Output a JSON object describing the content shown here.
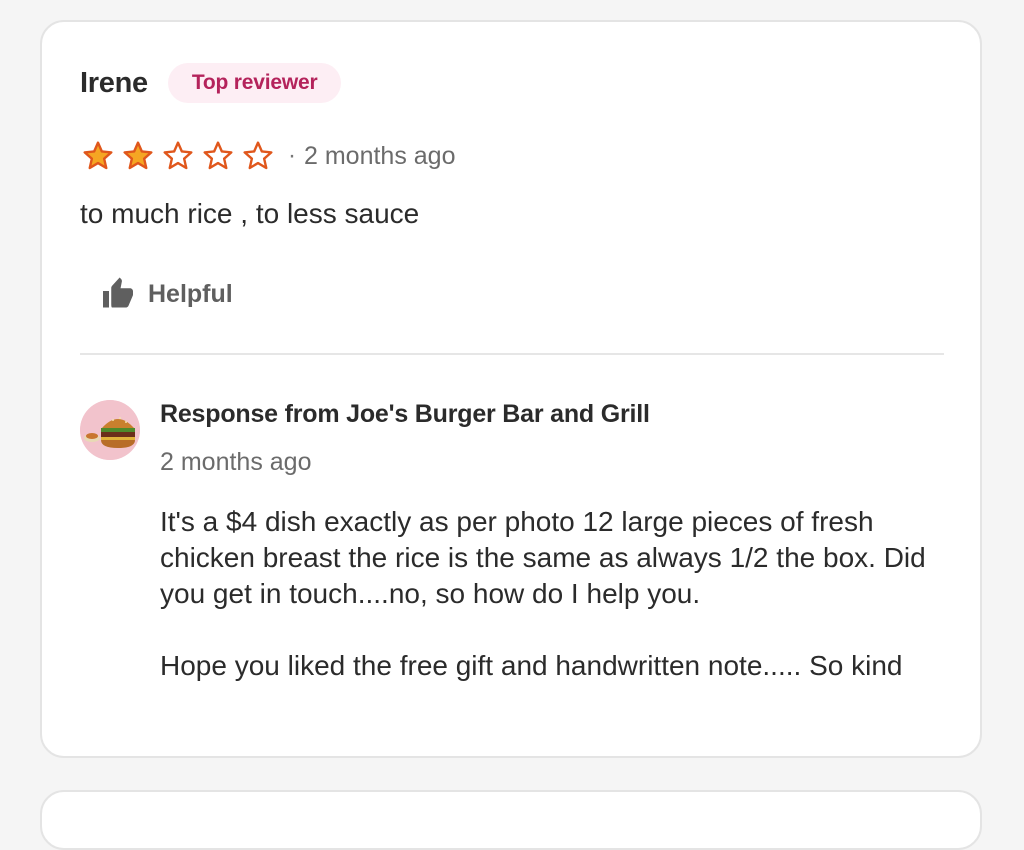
{
  "review": {
    "reviewer_name": "Irene",
    "badge": "Top reviewer",
    "rating": 2,
    "rating_max": 5,
    "separator": "·",
    "date": "2 months ago",
    "text": "to much rice , to less sauce",
    "helpful_label": "Helpful"
  },
  "response": {
    "title": "Response from Joe's Burger Bar and Grill",
    "date": "2 months ago",
    "paragraph_1": "It's a $4 dish exactly as per photo 12 large  pieces of fresh chicken breast the rice is the same as always 1/2 the box. Did you get in touch....no, so how do I  help you.",
    "paragraph_2": "Hope you liked the free gift and handwritten note..... So kind"
  },
  "colors": {
    "star_filled": "#f5a623",
    "star_outline": "#e0571c",
    "badge_text": "#b4235b",
    "badge_bg": "#fdeef4"
  }
}
